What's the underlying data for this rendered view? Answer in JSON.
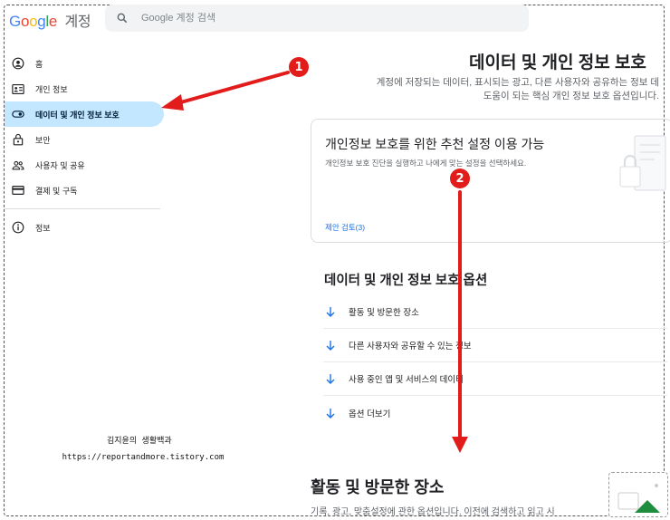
{
  "header": {
    "logo_letters": [
      "G",
      "o",
      "o",
      "g",
      "l",
      "e"
    ],
    "account_label": "계정",
    "search_placeholder": "Google 계정 검색"
  },
  "sidebar": {
    "items": [
      {
        "label": "홈",
        "icon": "home-icon"
      },
      {
        "label": "개인 정보",
        "icon": "id-card-icon"
      },
      {
        "label": "데이터 및 개인 정보 보호",
        "icon": "toggle-icon",
        "active": true
      },
      {
        "label": "보안",
        "icon": "lock-icon"
      },
      {
        "label": "사용자 및 공유",
        "icon": "people-icon"
      },
      {
        "label": "결제 및 구독",
        "icon": "credit-card-icon"
      }
    ],
    "info_item": {
      "label": "정보",
      "icon": "info-icon"
    }
  },
  "main": {
    "title": "데이터 및 개인 정보 보호",
    "description": "계정에 저장되는 데이터, 표시되는 광고, 다른 사용자와 공유하는 정보 데 도움이 되는 핵심 개인 정보 보호 옵션입니다.",
    "card": {
      "title": "개인정보 보호를 위한 추천 설정 이용 가능",
      "subtitle": "개인정보 보호 진단을 실행하고 나에게 맞는 설정을 선택하세요.",
      "link": "제안 검토(3)"
    },
    "options_title": "데이터 및 개인 정보 보호 옵션",
    "options": [
      "활동 및 방문한 장소",
      "다른 사용자와 공유할 수 있는 정보",
      "사용 중인 앱 및 서비스의 데이터",
      "옵션 더보기"
    ],
    "activity_title": "활동 및 방문한 장소",
    "activity_desc": "기록, 광고, 맞춤설정에 관한 옵션입니다. 이전에 검색하고 읽고 시"
  },
  "annotations": {
    "badge1": "1",
    "badge2": "2",
    "watermark_name": "김지윤의 생활백과",
    "watermark_url": "https://reportandmore.tistory.com"
  },
  "colors": {
    "active_bg": "#c2e7ff",
    "link": "#1a73e8",
    "annotation_red": "#e21b1b"
  }
}
